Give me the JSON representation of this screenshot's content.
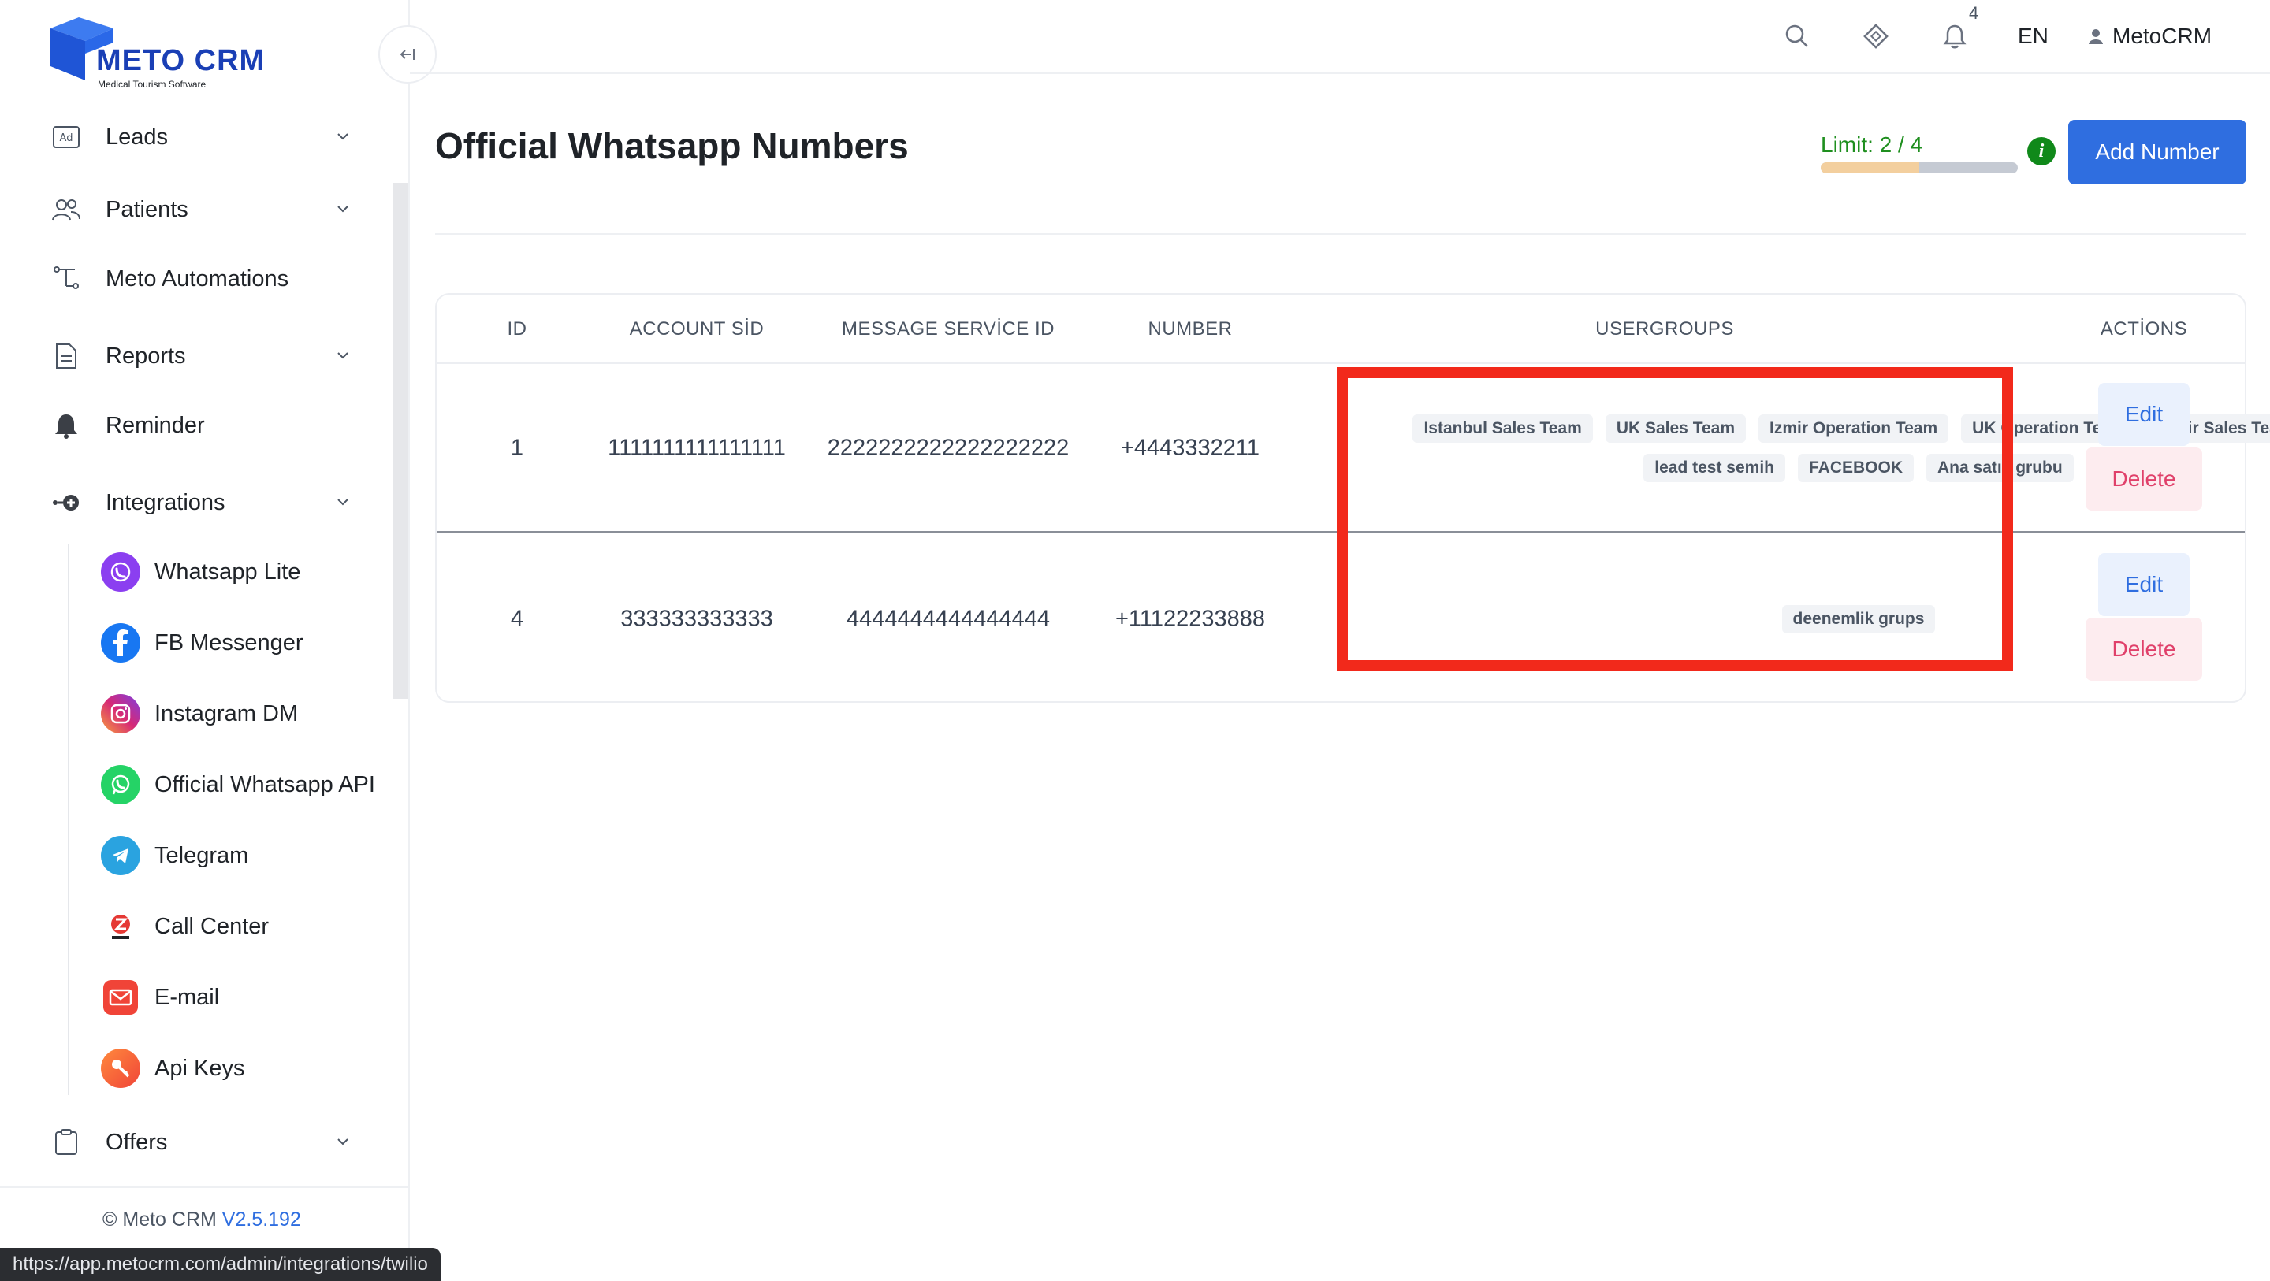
{
  "app": {
    "logo_text": "METO CRM",
    "logo_sub": "Medical Tourism Software"
  },
  "sidebar": {
    "items": [
      {
        "label": "Leads",
        "icon": "ad-icon",
        "has_chevron": true
      },
      {
        "label": "Patients",
        "icon": "users-icon",
        "has_chevron": true
      },
      {
        "label": "Meto Automations",
        "icon": "automation-icon",
        "has_chevron": false
      },
      {
        "label": "Reports",
        "icon": "document-icon",
        "has_chevron": true
      },
      {
        "label": "Reminder",
        "icon": "bell-icon",
        "has_chevron": false
      },
      {
        "label": "Integrations",
        "icon": "integrations-icon",
        "has_chevron": true
      },
      {
        "label": "Offers",
        "icon": "clipboard-icon",
        "has_chevron": true
      }
    ],
    "integrations_sub": [
      {
        "label": "Whatsapp Lite",
        "icon": "whatsapp-lite-icon",
        "color": "#8b3ff0"
      },
      {
        "label": "FB Messenger",
        "icon": "facebook-icon",
        "color": "#1877f2"
      },
      {
        "label": "Instagram DM",
        "icon": "instagram-icon",
        "color": "#d62976"
      },
      {
        "label": "Official Whatsapp API",
        "icon": "whatsapp-icon",
        "color": "#25d366"
      },
      {
        "label": "Telegram",
        "icon": "telegram-icon",
        "color": "#2aa3e0"
      },
      {
        "label": "Call Center",
        "icon": "zadarma-icon",
        "color": "#e53935"
      },
      {
        "label": "E-mail",
        "icon": "email-icon",
        "color": "#f04438"
      },
      {
        "label": "Api Keys",
        "icon": "key-icon",
        "color": "#f45a3c"
      }
    ],
    "footer": {
      "copyright": "© Meto CRM",
      "version": "V2.5.192"
    }
  },
  "status_url": "https://app.metocrm.com/admin/integrations/twilio",
  "topbar": {
    "notification_count": "4",
    "language": "EN",
    "user_name": "MetoCRM"
  },
  "main": {
    "title": "Official Whatsapp Numbers",
    "limit_label": "Limit: 2 / 4",
    "limit_fraction": 0.5,
    "info_glyph": "i",
    "add_button": "Add Number"
  },
  "table": {
    "headers": [
      "ID",
      "ACCOUNT SİD",
      "MESSAGE SERVİCE ID",
      "NUMBER",
      "USERGROUPS",
      "ACTİONS"
    ],
    "rows": [
      {
        "id": "1",
        "account_sid": "1111111111111111",
        "message_service_id": "2222222222222222222",
        "number": "+4443332211",
        "usergroups": [
          "Istanbul Sales Team",
          "UK Sales Team",
          "Izmir Operation Team",
          "UK Operation Team",
          "Izmir Sales Team",
          "lead test semih",
          "FACEBOOK",
          "Ana satış grubu"
        ],
        "edit": "Edit",
        "delete": "Delete"
      },
      {
        "id": "4",
        "account_sid": "333333333333",
        "message_service_id": "4444444444444444",
        "number": "+11122233888",
        "usergroups": [
          "deenemlik grups"
        ],
        "edit": "Edit",
        "delete": "Delete"
      }
    ]
  },
  "colors": {
    "primary": "#2f6ee0",
    "success": "#1f8f1f",
    "danger": "#e0406a",
    "highlight": "#f2291b"
  }
}
